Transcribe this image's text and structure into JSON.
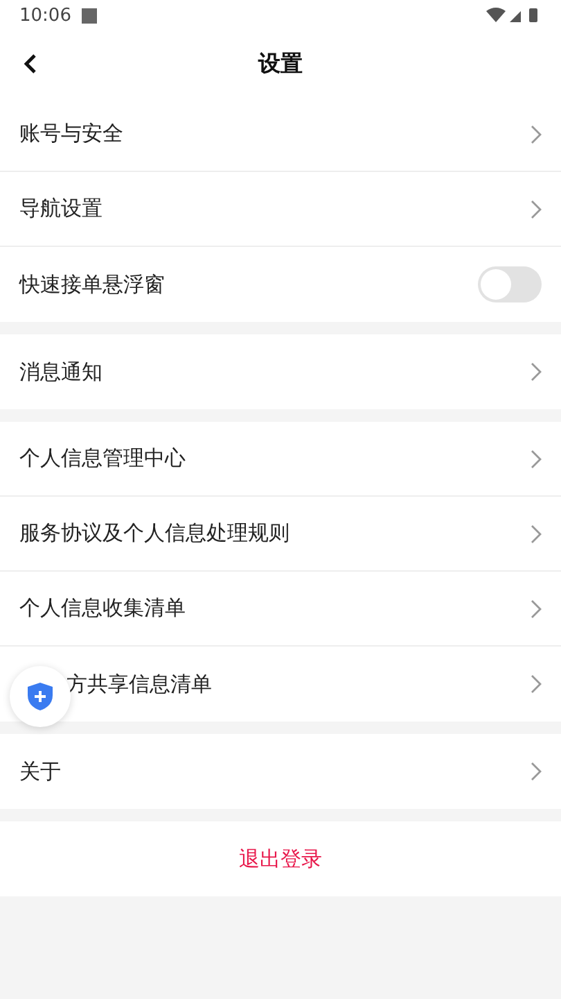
{
  "status_bar": {
    "time": "10:06"
  },
  "header": {
    "title": "设置"
  },
  "groups": [
    {
      "items": [
        {
          "kind": "link",
          "label": "账号与安全"
        },
        {
          "kind": "link",
          "label": "导航设置"
        },
        {
          "kind": "toggle",
          "label": "快速接单悬浮窗",
          "on": false
        }
      ]
    },
    {
      "items": [
        {
          "kind": "link",
          "label": "消息通知"
        }
      ]
    },
    {
      "items": [
        {
          "kind": "link",
          "label": "个人信息管理中心"
        },
        {
          "kind": "link",
          "label": "服务协议及个人信息处理规则"
        },
        {
          "kind": "link",
          "label": "个人信息收集清单"
        },
        {
          "kind": "link",
          "label": "方共享信息清单",
          "covered": true
        }
      ]
    },
    {
      "items": [
        {
          "kind": "link",
          "label": "关于"
        }
      ]
    }
  ],
  "logout": {
    "label": "退出登录"
  }
}
